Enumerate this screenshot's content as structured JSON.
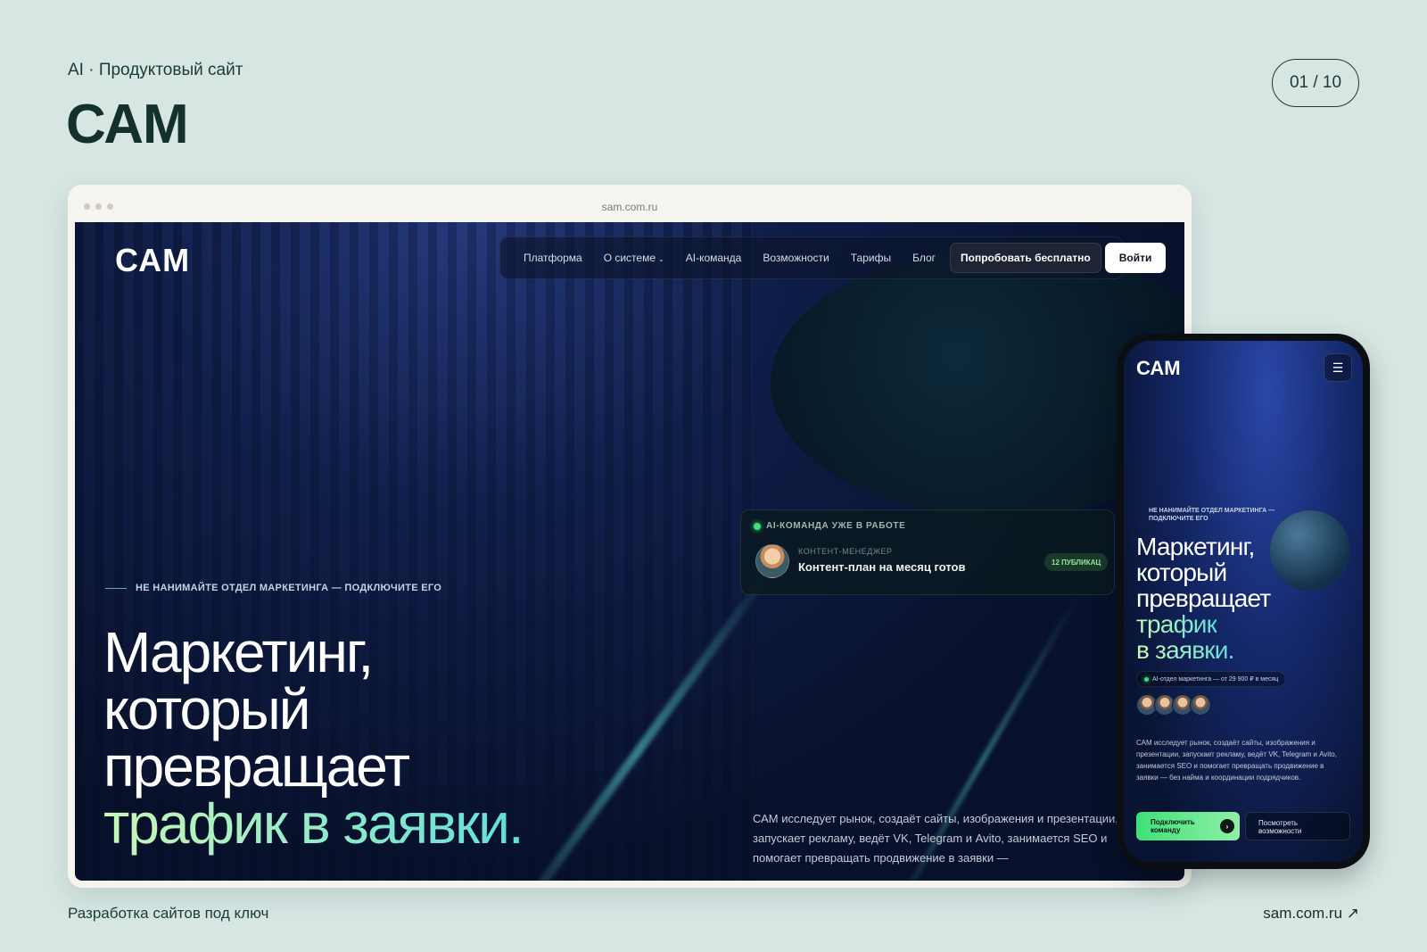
{
  "header": {
    "subtitle": "AI · Продуктовый сайт",
    "title": "САМ",
    "page_counter": "01 / 10"
  },
  "footer": {
    "left_text": "Разработка сайтов под ключ",
    "link": "sam.com.ru ↗"
  },
  "browser": {
    "url": "sam.com.ru"
  },
  "site": {
    "logo": "САМ",
    "nav": {
      "items": [
        "Платформа",
        "О системе",
        "AI-команда",
        "Возможности",
        "Тарифы",
        "Блог"
      ],
      "caret": "⌄",
      "try_button": "Попробовать бесплатно",
      "login_button": "Войти"
    },
    "status_card": {
      "heading": "AI-КОМАНДА УЖЕ В РАБОТЕ",
      "role": "КОНТЕНТ-МЕНЕДЖЕР",
      "task": "Контент-план на месяц готов",
      "badge": "12 ПУБЛИКАЦ"
    },
    "eyebrow": "НЕ НАНИМАЙТЕ ОТДЕЛ МАРКЕТИНГА — ПОДКЛЮЧИТЕ ЕГО",
    "hero": {
      "line1": "Маркетинг,",
      "line2": "который",
      "line3": "превращает",
      "accent": "трафик в заявки."
    },
    "description": "САМ исследует рынок, создаёт сайты, изображения и презентации, запускает рекламу, ведёт VK, Telegram и Avito, занимается SEO и помогает превращать продвижение в заявки —"
  },
  "phone": {
    "logo": "САМ",
    "menu_icon": "☰",
    "eyebrow": "НЕ НАНИМАЙТЕ ОТДЕЛ МАРКЕТИНГА — ПОДКЛЮЧИТЕ ЕГО",
    "hero": {
      "line1": "Маркетинг,",
      "line2": "который",
      "line3": "превращает",
      "accent1": "трафик",
      "accent2": "в заявки."
    },
    "pill": "AI-отдел маркетинга — от 29 900 ₽ в месяц",
    "description": "САМ исследует рынок, создаёт сайты, изображения и презентации, запускает рекламу, ведёт VK, Telegram и Avito, занимается SEO и помогает превращать продвижение в заявки — без найма и координации подрядчиков.",
    "primary_button": "Подключить команду",
    "secondary_button": "Посмотреть возможности",
    "arrow": "›"
  }
}
